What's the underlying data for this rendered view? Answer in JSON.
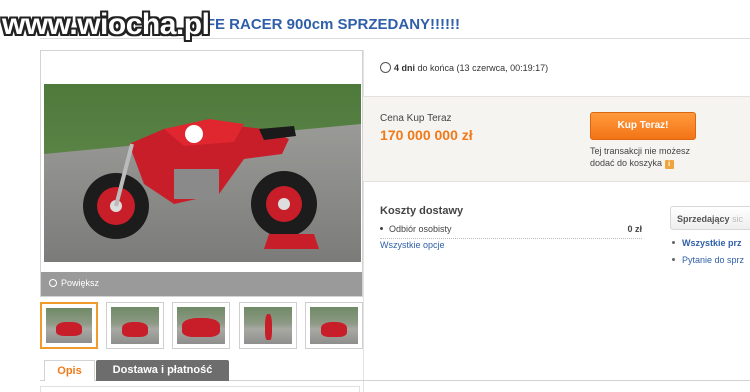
{
  "watermark": "www.wiocha.pl",
  "listing": {
    "title": "AFE RACER 900cm SPRZEDANY!!!!!!"
  },
  "gallery": {
    "zoom_label": "Powiększ",
    "thumbnail_count": 5
  },
  "timer": {
    "days": "4 dni",
    "suffix": "do końca (13 czerwca, 00:19:17)"
  },
  "purchase": {
    "price_label": "Cena Kup Teraz",
    "price": "170 000 000 zł",
    "buy_button": "Kup Teraz!",
    "cart_note": "Tej transakcji nie możesz dodać do koszyka",
    "info_icon": "i"
  },
  "shipping": {
    "title": "Koszty dostawy",
    "rows": [
      {
        "label": "Odbiór osobisty",
        "value": "0 zł"
      }
    ],
    "link": "Wszystkie opcje"
  },
  "seller": {
    "box_label": "Sprzedający",
    "box_faded": "sic",
    "link_all": "Wszystkie prz",
    "link_ask": "Pytanie do sprz"
  },
  "tabs": {
    "opis": "Opis",
    "dostawa": "Dostawa i płatność"
  },
  "colors": {
    "accent_orange": "#f07a1a",
    "link_blue": "#2f5fa8",
    "bike_red": "#c81e2a"
  }
}
